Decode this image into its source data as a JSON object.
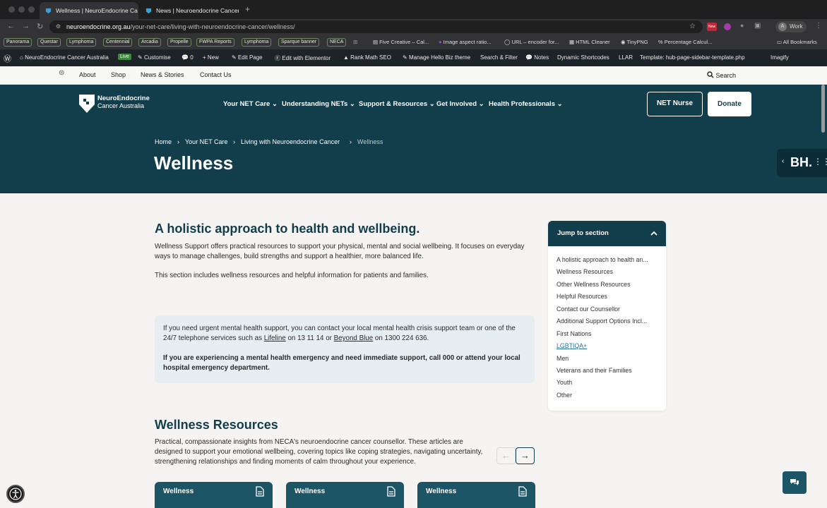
{
  "browser": {
    "tabs": [
      {
        "label": "Wellness | NeuroEndocrine Ca"
      },
      {
        "label": "News | Neuroendocrine Cancer"
      }
    ],
    "new_tab": "+",
    "url_host": "neuroendocrine.org.au",
    "url_path": "/your-net-care/living-with-neuroendocrine-cancer/wellness/",
    "profile_label": "Work",
    "ext_new_badge": "New"
  },
  "bookmarks": {
    "chips": [
      "Panorama",
      "Questar",
      "Lymphoma",
      "Centennial",
      "Arcadia",
      "Propelle",
      "FWPA Reports",
      "Lymphoma",
      "Sparque banner",
      "NECA"
    ],
    "links": [
      "Five Creative – Cal...",
      "Image aspect ratio...",
      "URL – encoder for...",
      "HTML Cleaner",
      "TinyPNG",
      "Percentage Calcul..."
    ],
    "all_bookmarks": "All Bookmarks"
  },
  "wpadmin": {
    "site_name": "NeuroEndocrine Cancer Australia",
    "live": "Live",
    "customise": "Customise",
    "comments": "0",
    "new": "New",
    "edit_page": "Edit Page",
    "elementor": "Edit with Elementor",
    "rankmath": "Rank Math SEO",
    "theme": "Manage Hello Biz theme",
    "search_filter": "Search & Filter",
    "notes": "Notes",
    "shortcodes": "Dynamic Shortcodes",
    "llar": "LLAR",
    "template": "Template: hub-page-sidebar-template.php",
    "imagify": "Imagify"
  },
  "utility": {
    "links": [
      "About",
      "Shop",
      "News & Stories",
      "Contact Us"
    ],
    "search": "Search"
  },
  "header": {
    "logo_line1": "NeuroEndocrine",
    "logo_line2": "Cancer Australia",
    "menu": [
      "Your NET Care",
      "Understanding NETs",
      "Support & Resources",
      "Get Involved",
      "Health Professionals"
    ],
    "btn_nurse": "NET Nurse",
    "btn_donate": "Donate",
    "breadcrumb": [
      "Home",
      "Your NET Care",
      "Living with Neuroendocrine Cancer",
      "Wellness"
    ],
    "crumb_sep": "›",
    "title": "Wellness",
    "bh_text": "BH."
  },
  "main": {
    "h1": "A holistic approach to health and wellbeing.",
    "p1": "Wellness Support offers practical resources to support your physical, mental and social wellbeing. It focuses on everyday ways to manage challenges, build strengths and support a healthier, more balanced life.",
    "p2": "This section includes wellness resources and helpful information for patients and families.",
    "alert_pre": "If you need urgent mental health support, you can contact your local mental health crisis support team or one of the 24/7 telephone services such as ",
    "alert_link1": "Lifeline",
    "alert_mid": " on 13 11 14 or ",
    "alert_link2": "Beyond Blue",
    "alert_post": " on 1300 224 636.",
    "alert_bold": "If you are experiencing a mental health emergency and need immediate support, call 000 or attend your local hospital emergency department.",
    "h2": "Wellness Resources",
    "p3": "Practical, compassionate insights from NECA's neuroendocrine cancer counsellor. These articles are designed to support your emotional wellbeing, covering topics like coping strategies, navigating uncertainty, strengthening relationships and finding moments of calm throughout your experience.",
    "prev_arrow": "←",
    "next_arrow": "→",
    "cards": [
      "Wellness",
      "Wellness",
      "Wellness"
    ]
  },
  "toc": {
    "title": "Jump to section",
    "items": [
      "A holistic approach to health an...",
      "Wellness Resources",
      "Other Wellness Resources",
      "Helpful Resources",
      "Contact our Counsellor",
      "Additional Support Options Incl...",
      "First Nations",
      "LGBTIQA+",
      "Men",
      "Veterans and their Families",
      "Youth",
      "Other"
    ]
  },
  "colors": {
    "brand": "#123d4a",
    "card": "#1c5566",
    "alert_bg": "#e6eef1",
    "link_active": "#2a6f9a"
  }
}
